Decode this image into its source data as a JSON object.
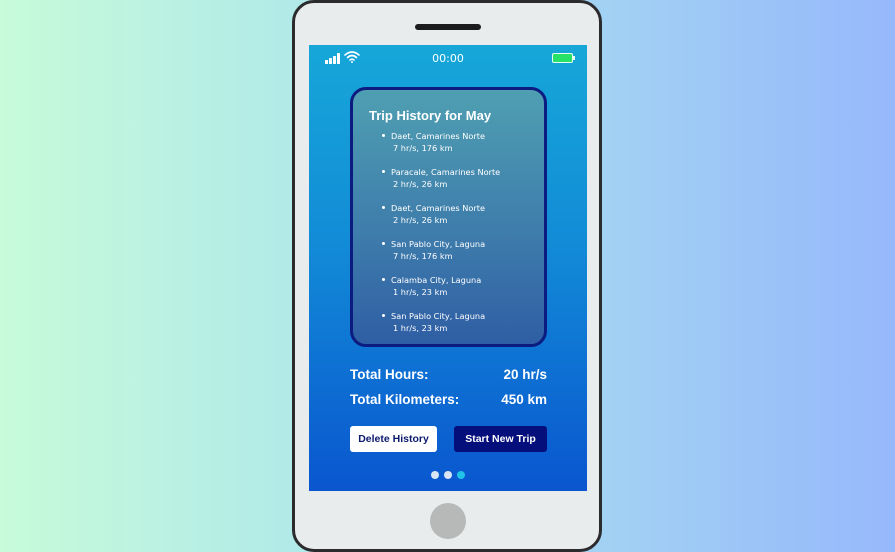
{
  "status_bar": {
    "time": "00:00"
  },
  "card": {
    "title": "Trip History for May",
    "trips": [
      {
        "place": "Daet, Camarines Norte",
        "stats": "7 hr/s, 176 km"
      },
      {
        "place": "Paracale, Camarines Norte",
        "stats": "2 hr/s, 26 km"
      },
      {
        "place": "Daet, Camarines Norte",
        "stats": "2 hr/s, 26 km"
      },
      {
        "place": "San Pablo City, Laguna",
        "stats": "7 hr/s, 176 km"
      },
      {
        "place": "Calamba City, Laguna",
        "stats": "1 hr/s, 23 km"
      },
      {
        "place": "San Pablo City, Laguna",
        "stats": "1 hr/s, 23 km"
      }
    ]
  },
  "totals": {
    "hours_label": "Total Hours:",
    "hours_value": "20 hr/s",
    "km_label": "Total Kilometers:",
    "km_value": "450 km"
  },
  "buttons": {
    "delete_label": "Delete History",
    "start_label": "Start New Trip"
  },
  "pagination": {
    "active_index": 2,
    "count": 3,
    "active_color": "#1fc4e6",
    "inactive_color": "#d9e4f5"
  },
  "colors": {
    "card_border": "#0b1b80",
    "start_button": "#050f7c",
    "battery": "#27e267"
  }
}
